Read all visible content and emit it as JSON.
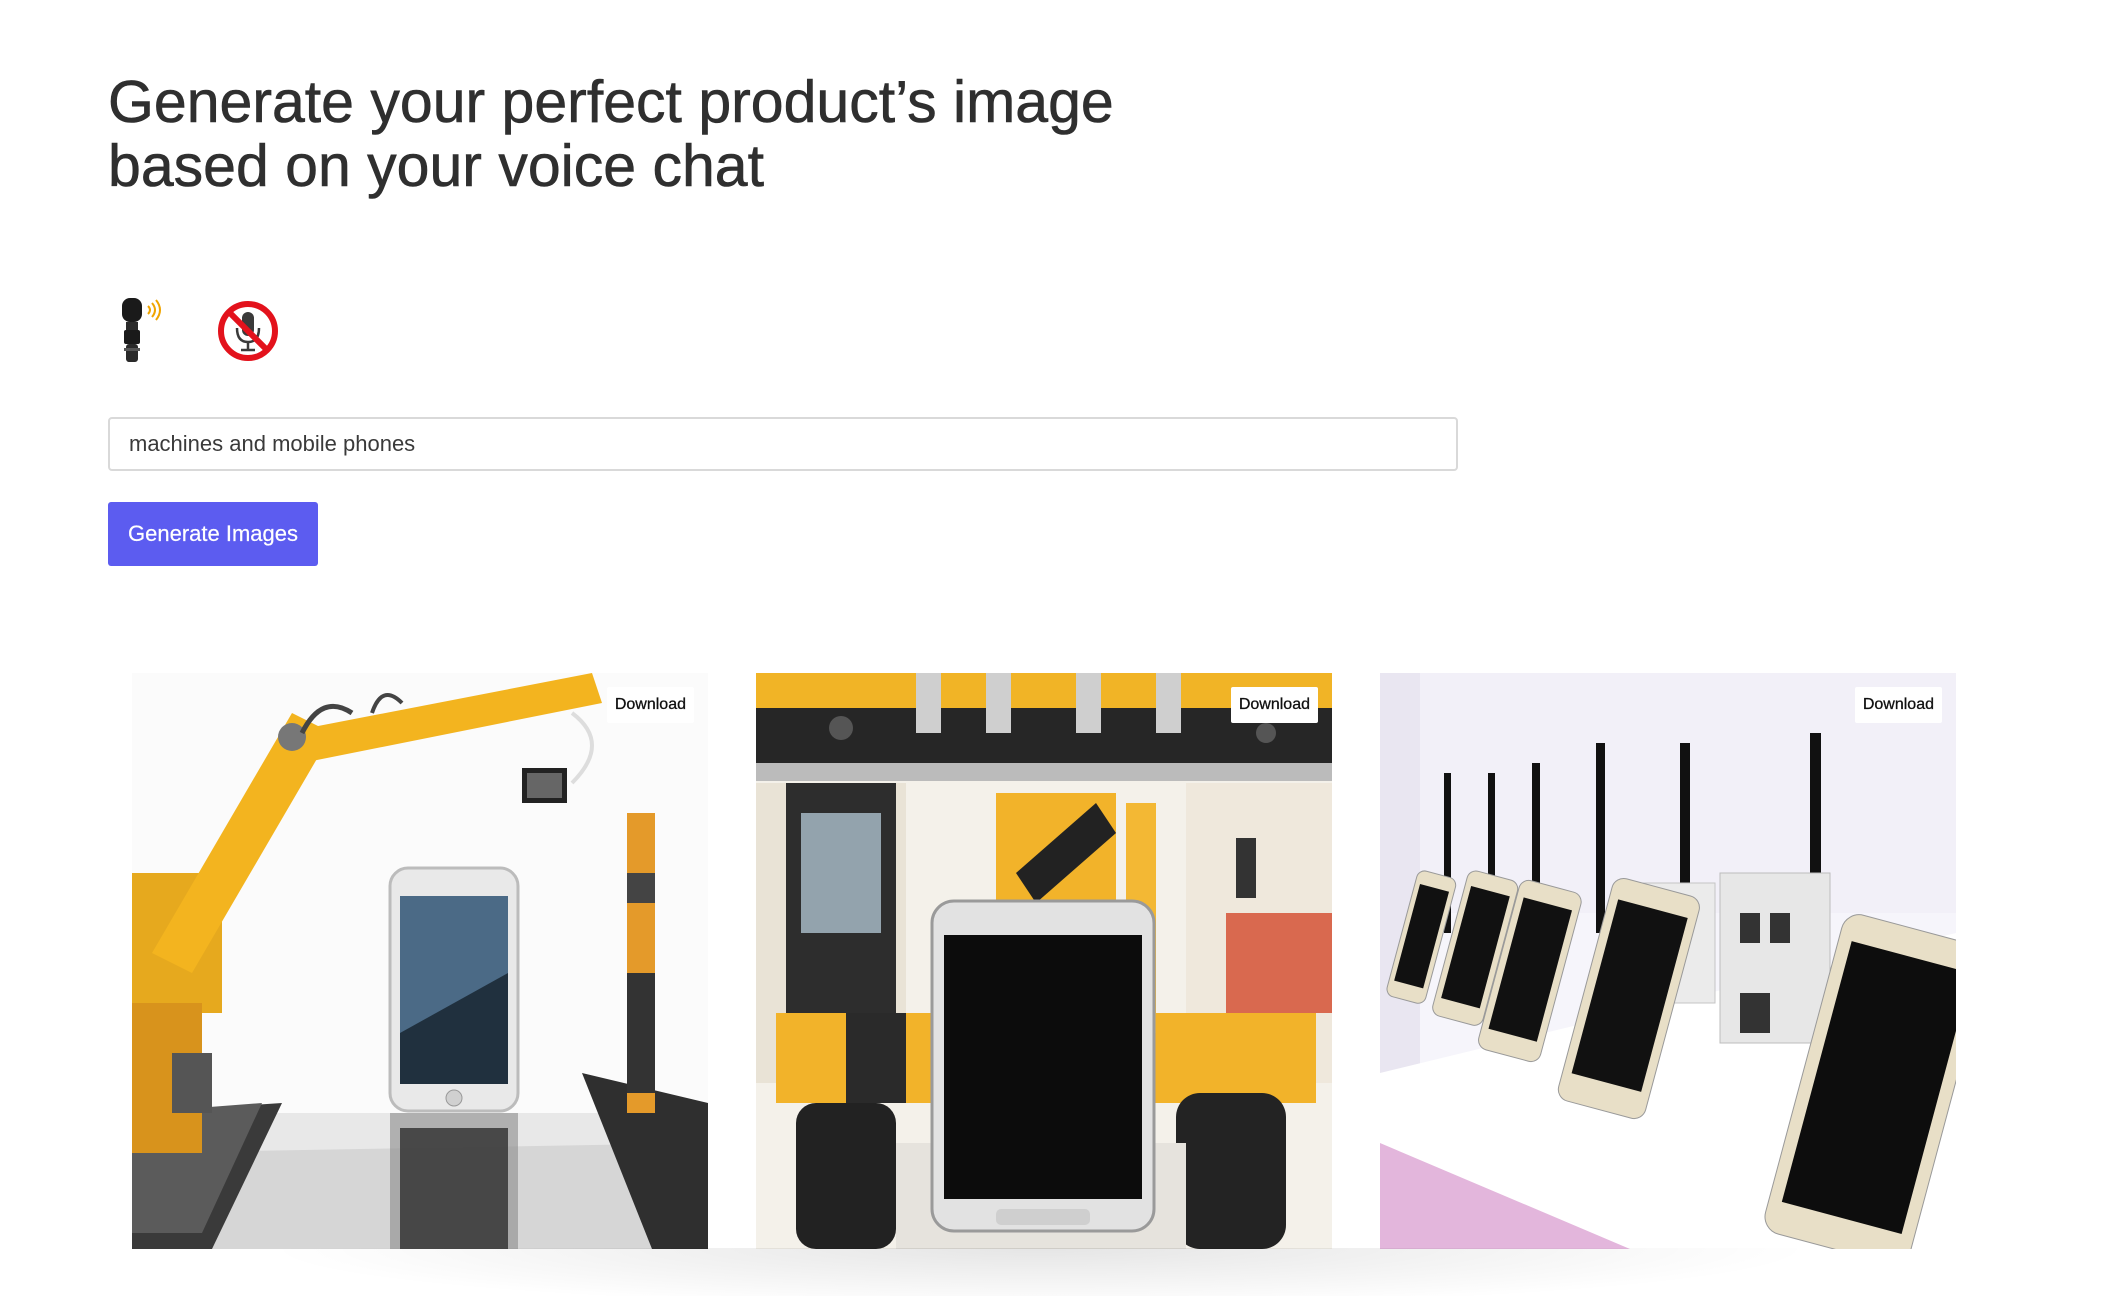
{
  "header": {
    "title_line1": "Generate your perfect product’s image",
    "title_line2": "based on your voice chat"
  },
  "controls": {
    "start_mic_icon": "microphone-icon",
    "stop_mic_icon": "microphone-muted-icon",
    "prompt_value": "machines and mobile phones",
    "generate_label": "Generate Images",
    "accent_color": "#5c5cf0"
  },
  "gallery": {
    "images": [
      {
        "subject": "phone-on-conveyor-with-robot-arm",
        "download_label": "Download"
      },
      {
        "subject": "phone-in-front-of-excavator",
        "download_label": "Download"
      },
      {
        "subject": "row-of-phones-on-display-stands",
        "download_label": "Download"
      }
    ]
  }
}
